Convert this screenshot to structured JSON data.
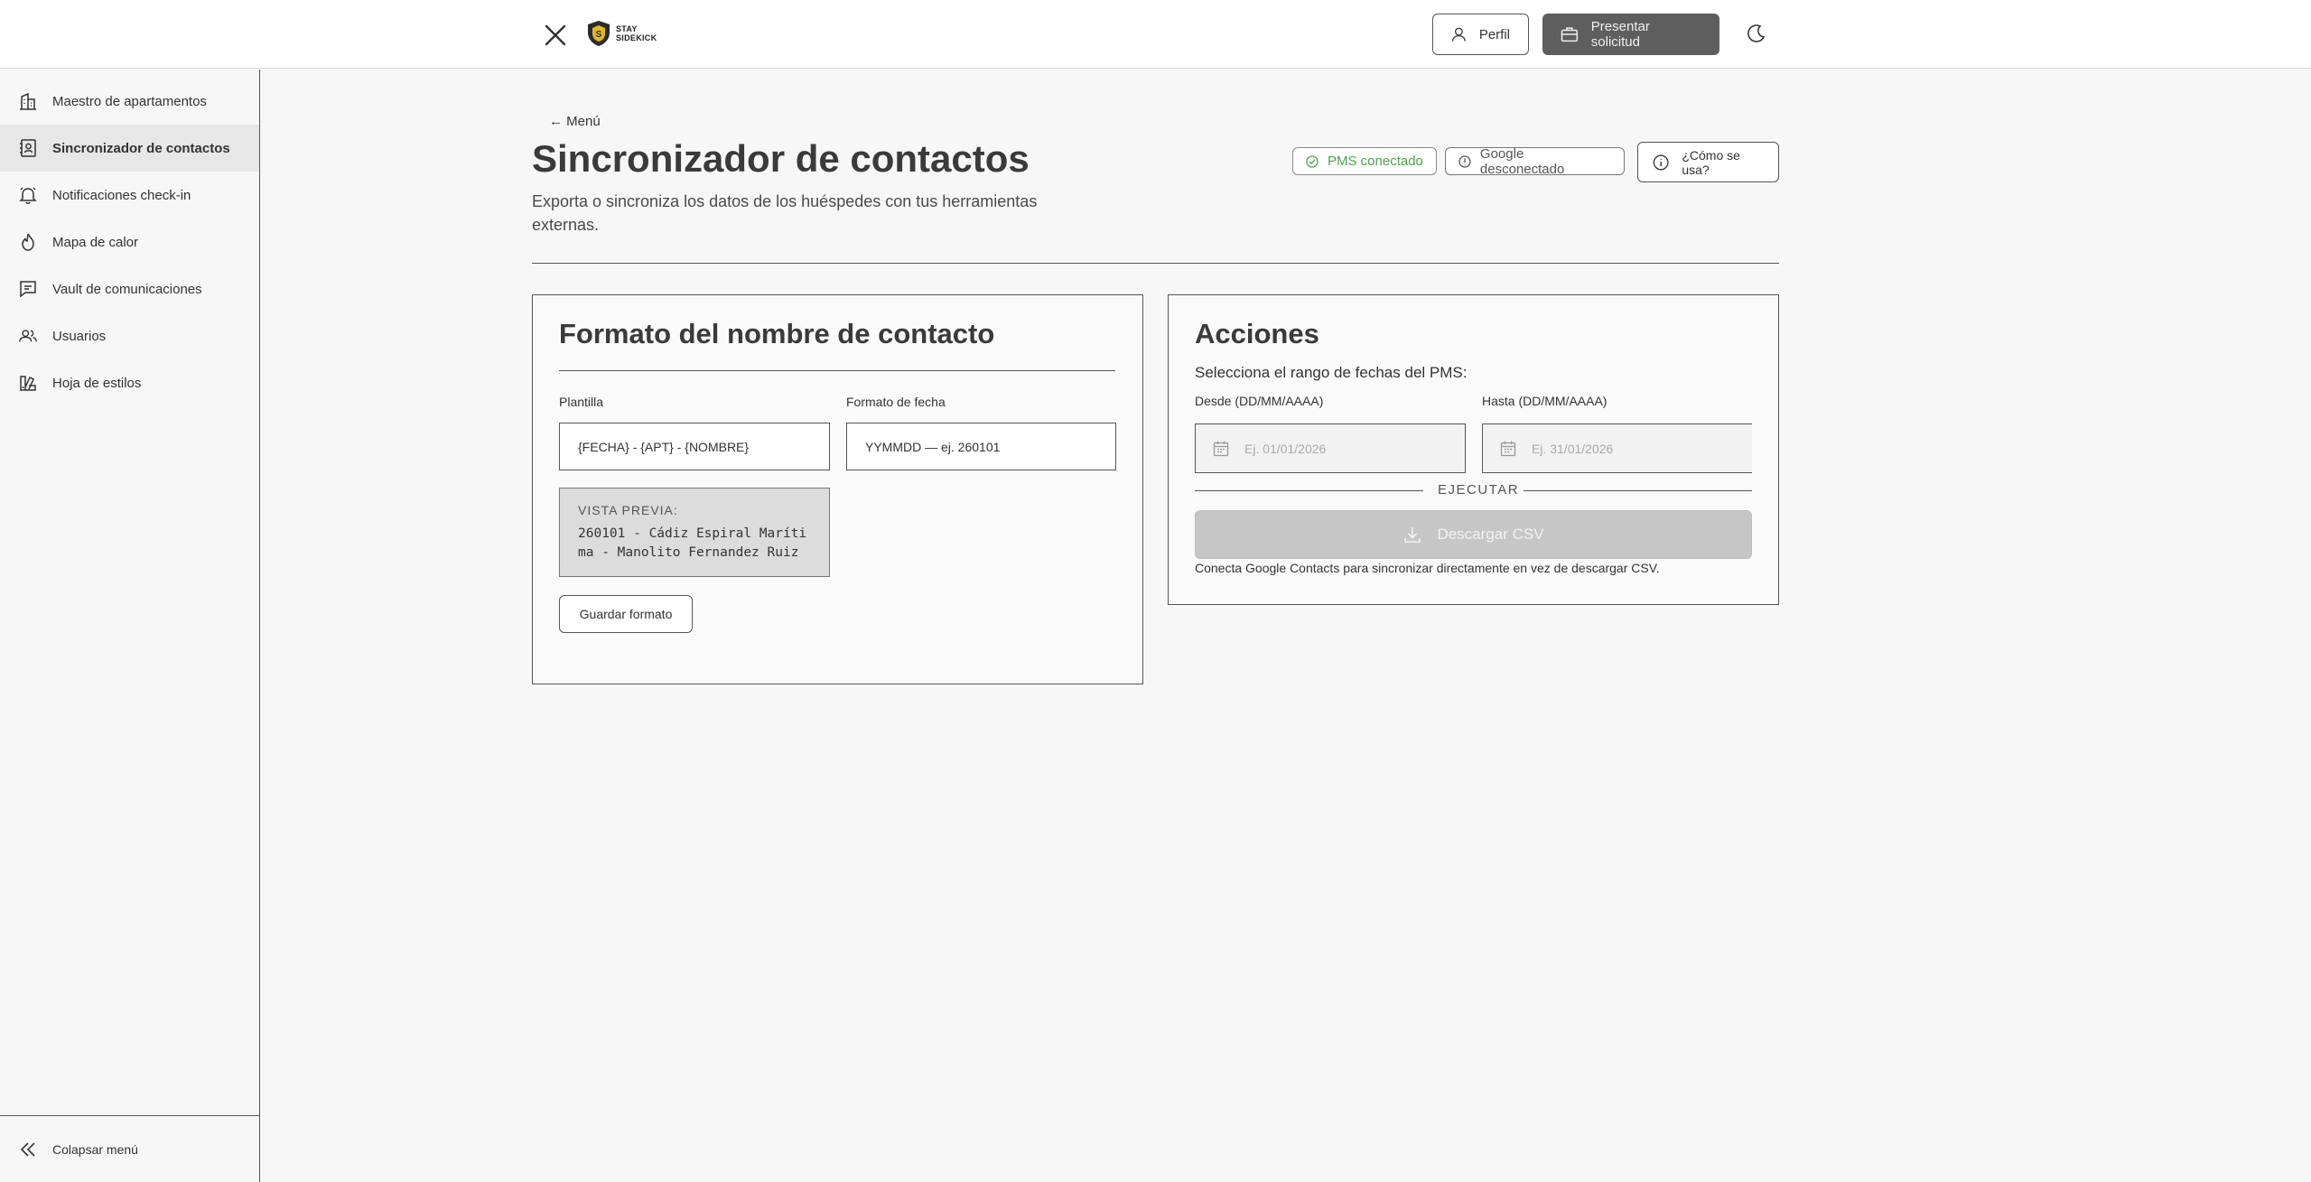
{
  "header": {
    "logo_text_1": "STAY",
    "logo_text_2": "SIDEKICK",
    "profile_label": "Perfil",
    "submit_label": "Presentar solicitud"
  },
  "sidebar": {
    "items": [
      {
        "label": "Maestro de apartamentos",
        "icon": "building-icon"
      },
      {
        "label": "Sincronizador de contactos",
        "icon": "contact-book-icon",
        "active": true
      },
      {
        "label": "Notificaciones check-in",
        "icon": "bell-icon"
      },
      {
        "label": "Mapa de calor",
        "icon": "flame-icon"
      },
      {
        "label": "Vault de comunicaciones",
        "icon": "message-icon"
      },
      {
        "label": "Usuarios",
        "icon": "users-icon"
      },
      {
        "label": "Hoja de estilos",
        "icon": "palette-icon"
      }
    ],
    "collapse_label": "Colapsar menú"
  },
  "page": {
    "back_label": "← Menú",
    "title": "Sincronizador de contactos",
    "subtitle": "Exporta o sincroniza los datos de los huéspedes con tus herramientas externas.",
    "badge_pms": "PMS conectado",
    "badge_google": "Google desconectado",
    "help_label": "¿Cómo se usa?"
  },
  "format_card": {
    "title": "Formato del nombre de contacto",
    "template_label": "Plantilla",
    "template_value": "{FECHA} - {APT} - {NOMBRE}",
    "date_format_label": "Formato de fecha",
    "date_format_value": "YYMMDD — ej. 260101",
    "preview_label": "VISTA PREVIA:",
    "preview_value": "260101 - Cádiz Espiral Marítima - Manolito Fernandez Ruiz",
    "save_label": "Guardar formato"
  },
  "actions_card": {
    "title": "Acciones",
    "subtitle": "Selecciona el rango de fechas del PMS:",
    "from_label": "Desde (DD/MM/AAAA)",
    "from_placeholder": "Ej. 01/01/2026",
    "to_label": "Hasta (DD/MM/AAAA)",
    "to_placeholder": "Ej. 31/01/2026",
    "execute_label": "EJECUTAR",
    "download_label": "Descargar CSV",
    "note": "Conecta Google Contacts para sincronizar directamente en vez de descargar CSV."
  },
  "colors": {
    "success": "#4ea34e",
    "dark_button": "#5e5e5e",
    "disabled_button": "#c6c6c6"
  }
}
